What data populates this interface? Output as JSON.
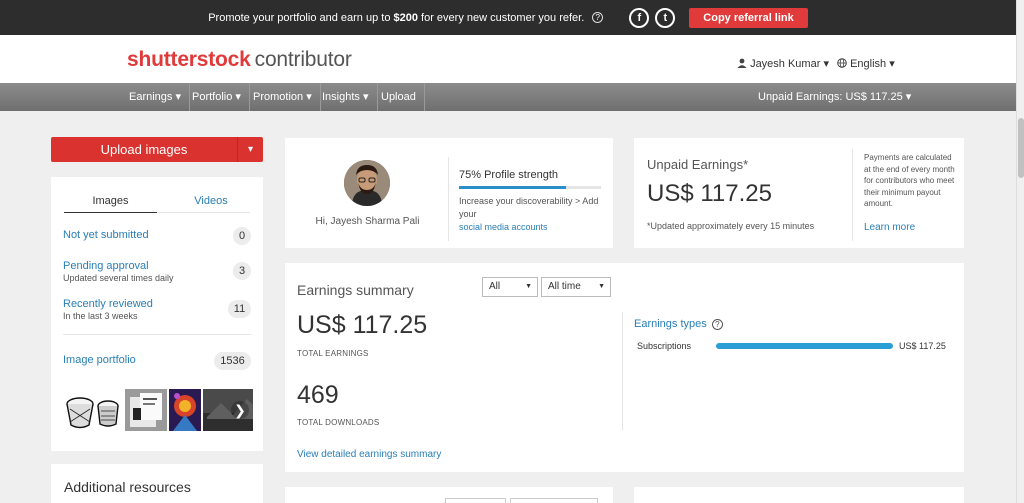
{
  "promo": {
    "text_before": "Promote your portfolio and earn up to ",
    "amount": "$200",
    "text_after": " for every new customer you refer.",
    "help_icon": "?",
    "facebook_icon": "f",
    "twitter_icon": "t",
    "referral_button": "Copy referral link"
  },
  "header": {
    "logo_brand": "shutterstock",
    "logo_sub": "contributor",
    "user": "Jayesh Kumar",
    "user_caret": "▾",
    "language": "English",
    "language_caret": "▾"
  },
  "nav": {
    "items": [
      {
        "label": "Earnings ▾"
      },
      {
        "label": "Portfolio ▾"
      },
      {
        "label": "Promotion ▾"
      },
      {
        "label": "Insights ▾"
      },
      {
        "label": "Upload"
      }
    ],
    "unpaid": "Unpaid Earnings: US$ 117.25 ▾"
  },
  "upload": {
    "label": "Upload images",
    "caret": "▾"
  },
  "left_panel": {
    "tabs": [
      "Images",
      "Videos"
    ],
    "rows": [
      {
        "label": "Not yet submitted",
        "sub": "",
        "count": "0"
      },
      {
        "label": "Pending approval",
        "sub": "Updated several times daily",
        "count": "3"
      },
      {
        "label": "Recently reviewed",
        "sub": "In the last 3 weeks",
        "count": "11"
      }
    ],
    "portfolio_label": "Image portfolio",
    "portfolio_count": "1536",
    "next_arrow": "❯"
  },
  "additional": {
    "title": "Additional resources"
  },
  "profile": {
    "greeting": "Hi, Jayesh Sharma Pali",
    "strength": "75% Profile strength",
    "strength_value": 0.75,
    "discover_text": "Increase your discoverability > Add your",
    "discover_link": "social media accounts"
  },
  "unpaid_card": {
    "title": "Unpaid Earnings*",
    "amount": "US$ 117.25",
    "updated": "*Updated approximately every 15 minutes",
    "note": "Payments are calculated at the end of every month for contributors who meet their minimum payout amount.",
    "learn_more": "Learn more"
  },
  "earnings": {
    "title": "Earnings summary",
    "filter1": "All",
    "filter2": "All time",
    "select_caret": "▼",
    "total_earnings": "US$ 117.25",
    "total_earnings_label": "TOTAL EARNINGS",
    "total_downloads": "469",
    "total_downloads_label": "TOTAL DOWNLOADS",
    "types_label": "Earnings types",
    "types_help": "?",
    "type_name": "Subscriptions",
    "type_value": "US$ 117.25",
    "detail_link": "View detailed earnings summary"
  },
  "colors": {
    "brand_red": "#e03a3a",
    "link_blue": "#2a7fb5",
    "bar_blue": "#2a9fd6"
  }
}
